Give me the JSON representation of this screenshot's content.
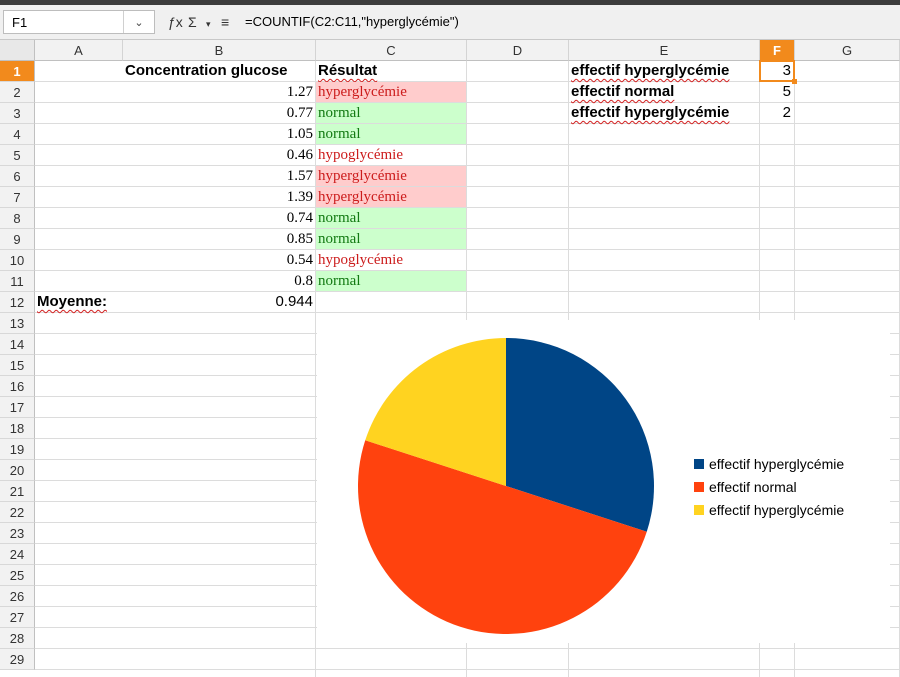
{
  "formula_bar": {
    "cell_ref": "F1",
    "formula": "=COUNTIF(C2:C11,\"hyperglycémie\")"
  },
  "columns": [
    "A",
    "B",
    "C",
    "D",
    "E",
    "F",
    "G"
  ],
  "selected_column": "F",
  "rows": [
    "1",
    "2",
    "3",
    "4",
    "5",
    "6",
    "7",
    "8",
    "9",
    "10",
    "11",
    "12",
    "13",
    "14",
    "15",
    "16",
    "17",
    "18",
    "19",
    "20",
    "21",
    "22",
    "23",
    "24",
    "25",
    "26",
    "27",
    "28",
    "29"
  ],
  "selected_row": "1",
  "sheet": {
    "header_b": "Concentration glucose",
    "header_c": "Résultat",
    "data": [
      {
        "value": "1.27",
        "result": "hyperglycémie",
        "status": "hyper"
      },
      {
        "value": "0.77",
        "result": "normal",
        "status": "normal"
      },
      {
        "value": "1.05",
        "result": "normal",
        "status": "normal"
      },
      {
        "value": "0.46",
        "result": "hypoglycémie",
        "status": "hypo"
      },
      {
        "value": "1.57",
        "result": "hyperglycémie",
        "status": "hyper"
      },
      {
        "value": "1.39",
        "result": "hyperglycémie",
        "status": "hyper"
      },
      {
        "value": "0.74",
        "result": "normal",
        "status": "normal"
      },
      {
        "value": "0.85",
        "result": "normal",
        "status": "normal"
      },
      {
        "value": "0.54",
        "result": "hypoglycémie",
        "status": "hypo"
      },
      {
        "value": "0.8",
        "result": "normal",
        "status": "normal"
      }
    ],
    "mean_label": "Moyenne:",
    "mean_value": "0.944",
    "summary": [
      {
        "label": "effectif hyperglycémie",
        "value": "3"
      },
      {
        "label": "effectif normal",
        "value": "5"
      },
      {
        "label": "effectif hyperglycémie",
        "value": "2"
      }
    ]
  },
  "colors": {
    "accent": "#f28a1c",
    "hyper_bg": "#ffcccc",
    "hyper_text": "#cc1c1c",
    "normal_bg": "#ccffcc",
    "normal_text": "#127a12"
  },
  "chart_data": {
    "type": "pie",
    "categories": [
      "effectif hyperglycémie",
      "effectif normal",
      "effectif hyperglycémie"
    ],
    "values": [
      3,
      5,
      2
    ],
    "colors": [
      "#004586",
      "#ff420e",
      "#ffd320"
    ],
    "legend_position": "right"
  }
}
